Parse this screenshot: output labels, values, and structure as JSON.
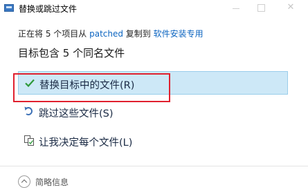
{
  "window": {
    "title": "替换或跳过文件",
    "minimize_glyph": "",
    "maximize_glyph": "",
    "close_glyph": "✕"
  },
  "progress": {
    "prefix": "正在将 5 个项目从 ",
    "source": "patched",
    "middle": " 复制到 ",
    "destination": "软件安装专用"
  },
  "heading": "目标包含 5 个同名文件",
  "options": [
    {
      "label": "替换目标中的文件(R)",
      "icon": "checkmark-icon"
    },
    {
      "label": "跳过这些文件(S)",
      "icon": "skip-arrow-icon"
    },
    {
      "label": "让我决定每个文件(L)",
      "icon": "file-compare-icon"
    }
  ],
  "footer": {
    "details_label": "简略信息",
    "icon": "chevron-up-icon"
  },
  "colors": {
    "accent_link": "#0b64c0",
    "selected_bg": "#cde8f7",
    "highlight_border": "#e0202e",
    "check_green": "#2e9a3a"
  }
}
